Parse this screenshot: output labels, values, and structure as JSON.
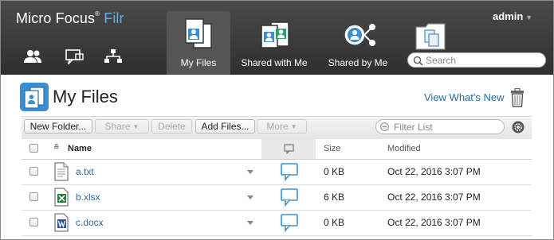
{
  "brand": {
    "name": "Micro Focus",
    "registered": "®",
    "product": "Filr"
  },
  "header_icons": [
    "users-icon",
    "chat-icon",
    "org-chart-icon"
  ],
  "nav": [
    {
      "label": "My Files",
      "icon": "my-files-icon",
      "active": true
    },
    {
      "label": "Shared with Me",
      "icon": "shared-with-me-icon",
      "active": false
    },
    {
      "label": "Shared by Me",
      "icon": "shared-by-me-icon",
      "active": false
    },
    {
      "label": "",
      "icon": "net-folders-icon",
      "active": false
    }
  ],
  "user": {
    "name": "admin",
    "caret": "▼"
  },
  "search": {
    "placeholder": "Search"
  },
  "page": {
    "title": "My Files",
    "whats_new": "View What's New"
  },
  "toolbar": {
    "new_folder": "New Folder...",
    "share": "Share",
    "delete": "Delete",
    "add_files": "Add Files...",
    "more": "More",
    "filter_placeholder": "Filter List"
  },
  "table": {
    "headers": {
      "name": "Name",
      "size": "Size",
      "modified": "Modified"
    },
    "rows": [
      {
        "name": "a.txt",
        "type": "text",
        "size": "0 KB",
        "modified": "Oct 22, 2016 3:07 PM"
      },
      {
        "name": "b.xlsx",
        "type": "excel",
        "size": "6 KB",
        "modified": "Oct 22, 2016 3:07 PM"
      },
      {
        "name": "c.docx",
        "type": "word",
        "size": "0 KB",
        "modified": "Oct 22, 2016 3:07 PM"
      }
    ]
  },
  "colors": {
    "header_bg": "#333333",
    "filr_blue": "#5ab0e8",
    "link_blue": "#2a6ea6",
    "icon_blue": "#3b8fd0"
  }
}
